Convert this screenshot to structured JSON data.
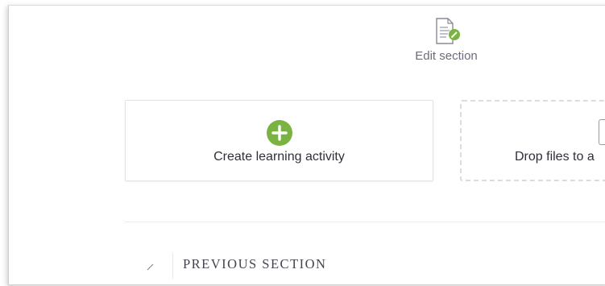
{
  "edit_section": {
    "label": "Edit section",
    "icon": "document-edit-icon",
    "icon_accent": "#7bb342"
  },
  "create_activity": {
    "label": "Create learning activity",
    "icon": "plus-circle-icon",
    "icon_color": "#7bb342"
  },
  "drop_zone": {
    "label": "Drop files to a",
    "icon": "file-upload-icon"
  },
  "previous_section": {
    "title": "PREVIOUS SECTION",
    "icon": "pencil-icon"
  }
}
